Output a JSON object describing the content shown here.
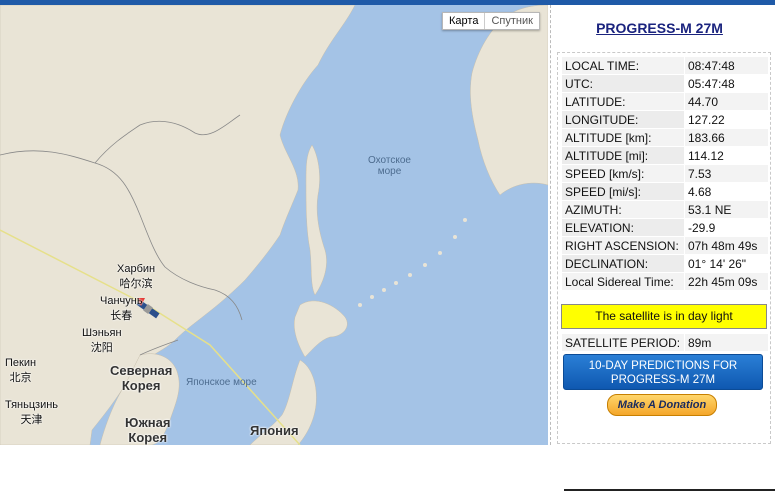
{
  "map": {
    "type_buttons": [
      "Карта",
      "Спутник"
    ],
    "labels": {
      "okhotsk_sea": [
        "Охотское",
        "море"
      ],
      "japan_sea": "Японское море",
      "harbin": [
        "Харбин",
        "哈尔滨"
      ],
      "changchun": [
        "Чанчунь",
        "长春"
      ],
      "shenyang": [
        "Шэньян",
        "沈阳"
      ],
      "beijing": [
        "Пекин",
        "北京"
      ],
      "tianjin": [
        "Тяньцзинь",
        "天津"
      ],
      "north_korea": [
        "Северная",
        "Корея"
      ],
      "south_korea": [
        "Южная",
        "Корея"
      ],
      "japan": "Япония"
    }
  },
  "panel": {
    "title": "PROGRESS-M 27M",
    "rows": [
      {
        "key": "LOCAL TIME:",
        "value": "08:47:48"
      },
      {
        "key": "UTC:",
        "value": "05:47:48"
      },
      {
        "key": "LATITUDE:",
        "value": "44.70"
      },
      {
        "key": "LONGITUDE:",
        "value": "127.22"
      },
      {
        "key": "ALTITUDE [km]:",
        "value": "183.66"
      },
      {
        "key": "ALTITUDE [mi]:",
        "value": "114.12"
      },
      {
        "key": "SPEED [km/s]:",
        "value": "7.53"
      },
      {
        "key": "SPEED [mi/s]:",
        "value": "4.68"
      },
      {
        "key": "AZIMUTH:",
        "value": "53.1 NE"
      },
      {
        "key": "ELEVATION:",
        "value": "-29.9"
      },
      {
        "key": "RIGHT ASCENSION:",
        "value": "07h 48m 49s"
      },
      {
        "key": "DECLINATION:",
        "value": "01° 14' 26\""
      },
      {
        "key": "Local Sidereal Time:",
        "value": "22h 45m 09s"
      }
    ],
    "daylight_status": "The satellite is in day light",
    "period": {
      "key": "SATELLITE PERIOD:",
      "value": "89m"
    },
    "predictions_button": [
      "10-DAY PREDICTIONS FOR",
      "PROGRESS-M 27M"
    ],
    "donate_button": "Make A Donation"
  }
}
